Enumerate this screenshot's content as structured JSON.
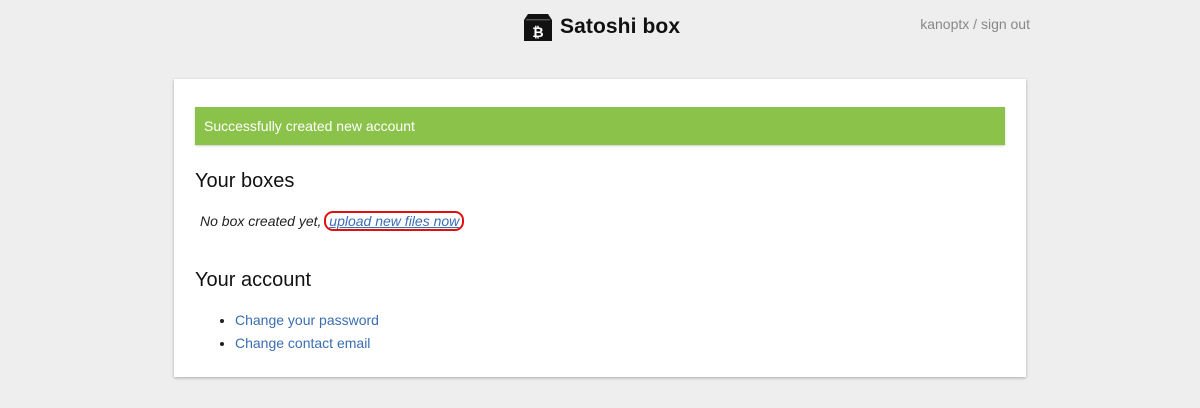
{
  "header": {
    "brand_name": "Satoshi box",
    "logo_icon": "bitcoin-box-icon",
    "username": "kanoptx",
    "separator": " / ",
    "signout_label": "sign out"
  },
  "alert": {
    "message": "Successfully created new account",
    "color": "#8bc34a"
  },
  "boxes": {
    "title": "Your boxes",
    "empty_text": "No box created yet, ",
    "upload_link": "upload new files now",
    "highlight_color": "#e01010"
  },
  "account": {
    "title": "Your account",
    "links": [
      {
        "label": "Change your password"
      },
      {
        "label": "Change contact email"
      }
    ]
  },
  "colors": {
    "link": "#3b6db3",
    "background": "#eeeeee"
  }
}
